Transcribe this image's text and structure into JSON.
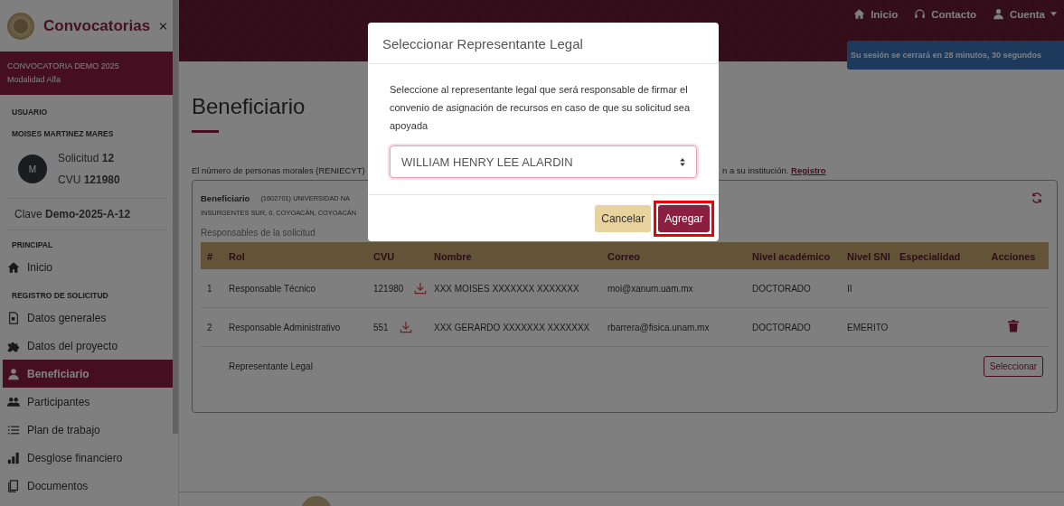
{
  "sidebar": {
    "title": "Convocatorias",
    "call": {
      "name": "CONVOCATORIA DEMO 2025",
      "modality": "Modalidad Alfa"
    },
    "user_label": "USUARIO",
    "user_name": "MOISES MARTINEZ MARES",
    "avatar": "M",
    "solicitud": "Solicitud **12**",
    "cvu": "CVU **121980**",
    "clave": "Clave **Demo-2025-A-12**",
    "sections": [
      {
        "heading": "PRINCIPAL",
        "items": [
          {
            "label": "Inicio",
            "selected": false
          }
        ]
      },
      {
        "heading": "REGISTRO DE SOLICITUD",
        "items": [
          {
            "label": "Datos generales",
            "selected": false
          },
          {
            "label": "Datos del proyecto",
            "selected": false
          },
          {
            "label": "Beneficiario",
            "selected": true
          },
          {
            "label": "Participantes",
            "selected": false
          },
          {
            "label": "Plan de trabajo",
            "selected": false
          },
          {
            "label": "Desglose financiero",
            "selected": false
          },
          {
            "label": "Documentos",
            "selected": false
          }
        ]
      }
    ]
  },
  "header": {
    "nav": [
      {
        "label": "Inicio",
        "dropdown": false
      },
      {
        "label": "Contacto",
        "dropdown": false
      },
      {
        "label": "Cuenta",
        "dropdown": true
      }
    ],
    "session_alert": "Su sesión se cerrará en 28 minutos, 30 segundos"
  },
  "page": {
    "title": "Beneficiario",
    "notice_left": "El número de personas morales (RENIECYT)",
    "notice_right": "n a su institución.",
    "notice_link": "Registro",
    "beneficiary": {
      "label": "Beneficiario",
      "line1": "(1602701) UNIVERSIDAD NA",
      "line2": "INSURGENTES SUR, 0, COYOACÁN, COYOACÁN"
    },
    "table_caption": "Responsables de la solicitud",
    "table": {
      "columns": [
        "#",
        "Rol",
        "CVU",
        "Nombre",
        "Correo",
        "Nivel académico",
        "Nivel SNI",
        "Especialidad",
        "Acciones"
      ],
      "rows": [
        {
          "kind": "member",
          "number": "1",
          "role": "Responsable Técnico",
          "cvu": "121980",
          "name": "XXX MOISES XXXXXXX XXXXXXX",
          "email": "moi@xanum.uam.mx",
          "level": "DOCTORADO",
          "sni": "II",
          "deletable": false
        },
        {
          "kind": "member",
          "number": "2",
          "role": "Responsable Administrativo",
          "cvu": "551",
          "name": "XXX GERARDO XXXXXXX XXXXXXX",
          "email": "rbarrera@fisica.unam.mx",
          "level": "DOCTORADO",
          "sni": "EMERITO",
          "deletable": true
        },
        {
          "kind": "pending",
          "role": "Representante Legal",
          "action": "Seleccionar"
        }
      ]
    }
  },
  "modal": {
    "title": "Seleccionar Representante Legal",
    "message": "Seleccione al representante legal que será responsable de firmar el convenio de asignación de recursos en caso de que su solicitud sea apoyada",
    "select_value": "WILLIAM HENRY LEE ALARDIN",
    "buttons": [
      {
        "label": "Cancelar",
        "kind": "secondary",
        "highlighted": false
      },
      {
        "label": "Agregar",
        "kind": "primary",
        "highlighted": true
      }
    ]
  }
}
